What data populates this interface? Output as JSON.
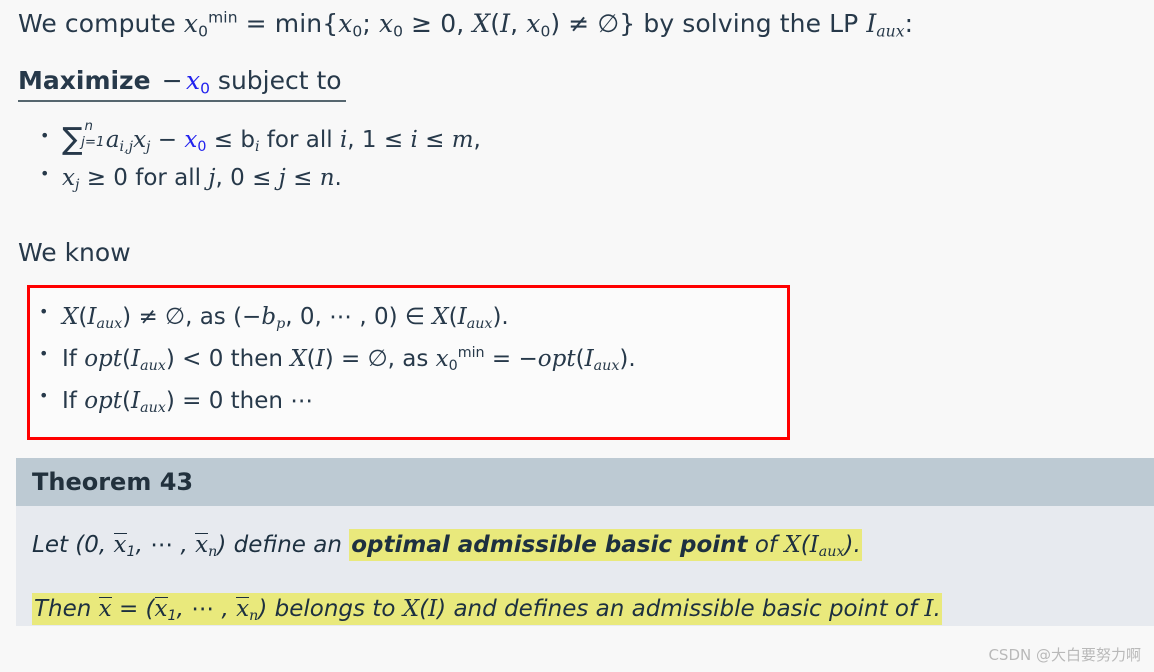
{
  "slide": {
    "background_color": "#f8f8f8",
    "text_color": "#27394a",
    "accent_blue": "#2222ee",
    "highlight_yellow": "#e9e97c",
    "red_box_color": "#ff0000",
    "theorem_header_bg": "#bdcad3",
    "theorem_body_bg": "#e7eaef"
  },
  "intro": {
    "prefix": "We compute ",
    "var_x": "x",
    "var_sub": "0",
    "var_sup": "min",
    "eq": " = min{",
    "x0_a": "x",
    "semi": "; ",
    "x0_b": "x",
    "ge": " ≥ 0, ",
    "X": "X",
    "paren_open": "(",
    "I": "I",
    "comma": ", ",
    "x0_c": "x",
    "paren_close": ")",
    "neq_empty": " ≠ ∅}",
    "suffix": " by solving the LP ",
    "lp_name": "I",
    "lp_sub": "aux",
    "colon": ":",
    "full_text": "We compute x_0^min = min{x_0; x_0 ≥ 0, X(I,x_0) ≠ ∅} by solving the LP I_aux:"
  },
  "maximize": {
    "word": "Maximize",
    "minus": "−",
    "objective_var": "x",
    "objective_sub": "0",
    "subject_to": " subject to",
    "full_text": "Maximize −x_0 subject to"
  },
  "constraints": [
    {
      "id": "constraint-sum",
      "text": "∑_{j=1}^{n} a_{i,j} x_j − x_0 ≤ b_i for all i, 1 ≤ i ≤ m,",
      "sum_upper": "n",
      "sum_lower": "j=1",
      "coef": "a",
      "coef_sub": "i,j",
      "xj": "x",
      "xj_sub": "j",
      "minus": " − ",
      "x0": "x",
      "x0_sub": "0",
      "le_b": " ≤ b",
      "b_sub": "i",
      "tail": " for all ",
      "i1": "i",
      "range": ", 1 ≤ ",
      "i2": "i",
      "range2": " ≤ ",
      "m": "m",
      "end": ","
    },
    {
      "id": "constraint-nonneg",
      "text": "x_j ≥ 0 for all j, 0 ≤ j ≤ n.",
      "xj": "x",
      "xj_sub": "j",
      "ge0": " ≥ 0 for all ",
      "j1": "j",
      "range": ", 0 ≤ ",
      "j2": "j",
      "range2": " ≤ ",
      "n": "n",
      "end": "."
    }
  ],
  "we_know": {
    "label": "We know"
  },
  "facts": [
    {
      "id": "fact-nonempty",
      "text": "X(I_aux) ≠ ∅, as (−b_p, 0, ⋯, 0) ∈ X(I_aux).",
      "X1": "X",
      "I1": "I",
      "I1_sub": "aux",
      "mid": ") ≠ ∅, as (−",
      "b": "b",
      "b_sub": "p",
      "zeros": ", 0, ⋯ , 0) ∈ ",
      "X2": "X",
      "I2": "I",
      "I2_sub": "aux",
      "end": ")."
    },
    {
      "id": "fact-negative-opt",
      "text": "If opt(I_aux) < 0 then X(I) = ∅, as x_0^min = −opt(I_aux).",
      "if": "If ",
      "opt": "opt",
      "I1": "I",
      "I1_sub": "aux",
      "lt": ") < 0 then ",
      "X": "X",
      "I2": "I",
      "empty": ") = ∅, as ",
      "x": "x",
      "x_sub": "0",
      "x_sup": "min",
      "eq_minus": " = −",
      "opt2": "opt",
      "I3": "I",
      "I3_sub": "aux",
      "end": ")."
    },
    {
      "id": "fact-zero-opt",
      "text": "If opt(I_aux) = 0 then ⋯",
      "if": "If ",
      "opt": "opt",
      "I1": "I",
      "I1_sub": "aux",
      "end": ") = 0 then ⋯"
    }
  ],
  "theorem": {
    "title": "Theorem 43",
    "line1": {
      "lead": "Let (0, x̄1, ⋯ , x̄n) define an ",
      "lead_pre": "Let ",
      "paren": "(0, ",
      "xbar": "x",
      "sub1": "1",
      "dots": ", ⋯ , ",
      "xbar2": "x",
      "subn": "n",
      "after": ") define an ",
      "highlight_bold": "optimal admissible basic point",
      "highlight_rest_pre": " of ",
      "X": "X",
      "I": "I",
      "I_sub": "aux",
      "highlight_end": ").",
      "full_text": "Let (0, x̄1, ⋯ , x̄n) define an optimal admissible basic point of X(I_aux)."
    },
    "line2": {
      "lead": "Then ",
      "xbar": "x",
      "eq": " = (",
      "xbar1": "x",
      "sub1": "1",
      "dots": ", ⋯ , ",
      "xbarn": "x",
      "subn": "n",
      "tail": ") belongs to ",
      "X": "X",
      "I": "I",
      "mid": ") and defines an admissible basic point of ",
      "I2": "I",
      "end": ".",
      "full_text": "Then x̄ = (x̄1, ⋯ , x̄n) belongs to X(I) and defines an admissible basic point of I."
    }
  },
  "watermark": {
    "text": "CSDN @大白要努力啊"
  }
}
